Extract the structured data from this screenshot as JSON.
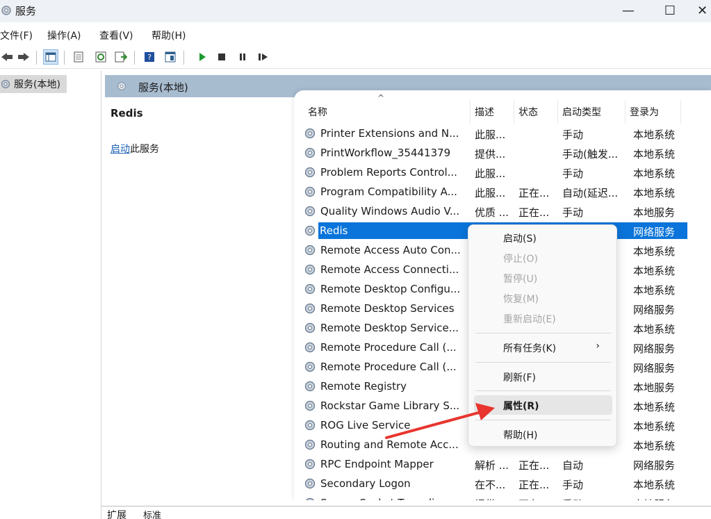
{
  "window": {
    "title": "服务",
    "minimize_glyph": "—",
    "maximize_glyph": "☐",
    "close_glyph": "✕"
  },
  "menu": [
    "文件(F)",
    "操作(A)",
    "查看(V)",
    "帮助(H)"
  ],
  "toolbar_icons": [
    "back-icon",
    "forward-icon",
    "console-tree-icon",
    "properties-icon",
    "refresh-icon",
    "export-list-icon",
    "help-icon",
    "show-pane-icon",
    "start-service-icon",
    "stop-service-icon",
    "pause-service-icon",
    "resume-service-icon"
  ],
  "tree": {
    "root_label": "服务(本地)"
  },
  "pane": {
    "header_label": "服务(本地)",
    "selected_service": "Redis",
    "start_link": "启动",
    "start_suffix": "此服务"
  },
  "columns": {
    "name": "名称",
    "desc": "描述",
    "status": "状态",
    "startup": "启动类型",
    "logon": "登录为"
  },
  "services": [
    {
      "name": "Printer Extensions and N...",
      "desc": "此服...",
      "status": "",
      "startup": "手动",
      "logon": "本地系统"
    },
    {
      "name": "PrintWorkflow_35441379",
      "desc": "提供...",
      "status": "",
      "startup": "手动(触发...",
      "logon": "本地系统"
    },
    {
      "name": "Problem Reports Control...",
      "desc": "此服...",
      "status": "",
      "startup": "手动",
      "logon": "本地系统"
    },
    {
      "name": "Program Compatibility A...",
      "desc": "此服...",
      "status": "正在...",
      "startup": "自动(延迟...",
      "logon": "本地系统"
    },
    {
      "name": "Quality Windows Audio V...",
      "desc": "优质 ...",
      "status": "正在...",
      "startup": "手动",
      "logon": "本地服务"
    },
    {
      "name": "Redis",
      "desc": "",
      "status": "",
      "startup": "",
      "logon": "网络服务"
    },
    {
      "name": "Remote Access Auto Con...",
      "desc": "",
      "status": "",
      "startup": "",
      "logon": "本地系统"
    },
    {
      "name": "Remote Access Connecti...",
      "desc": "",
      "status": "",
      "startup": "",
      "logon": "本地系统"
    },
    {
      "name": "Remote Desktop Configu...",
      "desc": "",
      "status": "",
      "startup": "",
      "logon": "本地系统"
    },
    {
      "name": "Remote Desktop Services",
      "desc": "",
      "status": "",
      "startup": "",
      "logon": "网络服务"
    },
    {
      "name": "Remote Desktop Service...",
      "desc": "",
      "status": "",
      "startup": "",
      "logon": "本地系统"
    },
    {
      "name": "Remote Procedure Call (...",
      "desc": "",
      "status": "",
      "startup": "",
      "logon": "网络服务"
    },
    {
      "name": "Remote Procedure Call (...",
      "desc": "",
      "status": "",
      "startup": "",
      "logon": "网络服务"
    },
    {
      "name": "Remote Registry",
      "desc": "",
      "status": "",
      "startup": "",
      "logon": "本地服务"
    },
    {
      "name": "Rockstar Game Library S...",
      "desc": "",
      "status": "",
      "startup": "",
      "logon": "本地系统"
    },
    {
      "name": "ROG Live Service",
      "desc": "",
      "status": "",
      "startup": "",
      "logon": "本地系统"
    },
    {
      "name": "Routing and Remote Acc...",
      "desc": "",
      "status": "",
      "startup": "",
      "logon": "本地系统"
    },
    {
      "name": "RPC Endpoint Mapper",
      "desc": "解析 ...",
      "status": "正在...",
      "startup": "自动",
      "logon": "网络服务"
    },
    {
      "name": "Secondary Logon",
      "desc": "在不...",
      "status": "正在...",
      "startup": "手动",
      "logon": "本地系统"
    },
    {
      "name": "Secure Socket Tunneling ...",
      "desc": "提供...",
      "status": "正在...",
      "startup": "手动",
      "logon": "本地服务"
    }
  ],
  "context_menu": {
    "start": "启动(S)",
    "stop": "停止(O)",
    "pause": "暂停(U)",
    "resume": "恢复(M)",
    "restart": "重新启动(E)",
    "all_tasks": "所有任务(K)",
    "all_tasks_arrow": "›",
    "refresh": "刷新(F)",
    "properties": "属性(R)",
    "help": "帮助(H)"
  },
  "tabs": [
    "扩展",
    "标准"
  ],
  "colors": {
    "selection": "#0a74da",
    "pane_header": "#a8bcd0",
    "annotation_arrow": "#e8352e"
  }
}
